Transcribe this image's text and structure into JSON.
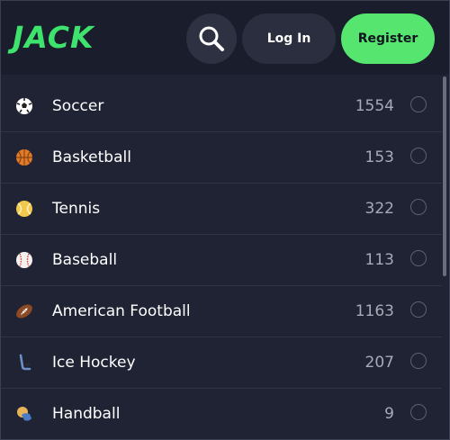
{
  "header": {
    "logo": "JACK",
    "login_label": "Log In",
    "register_label": "Register"
  },
  "colors": {
    "accent": "#56e56e",
    "background": "#1f2333",
    "header": "#1a1d2b"
  },
  "sports": [
    {
      "name": "Soccer",
      "count": "1554",
      "icon": "soccer-ball-icon"
    },
    {
      "name": "Basketball",
      "count": "153",
      "icon": "basketball-icon"
    },
    {
      "name": "Tennis",
      "count": "322",
      "icon": "tennis-ball-icon"
    },
    {
      "name": "Baseball",
      "count": "113",
      "icon": "baseball-icon"
    },
    {
      "name": "American Football",
      "count": "1163",
      "icon": "american-football-icon"
    },
    {
      "name": "Ice Hockey",
      "count": "207",
      "icon": "ice-hockey-icon"
    },
    {
      "name": "Handball",
      "count": "9",
      "icon": "handball-icon"
    }
  ]
}
